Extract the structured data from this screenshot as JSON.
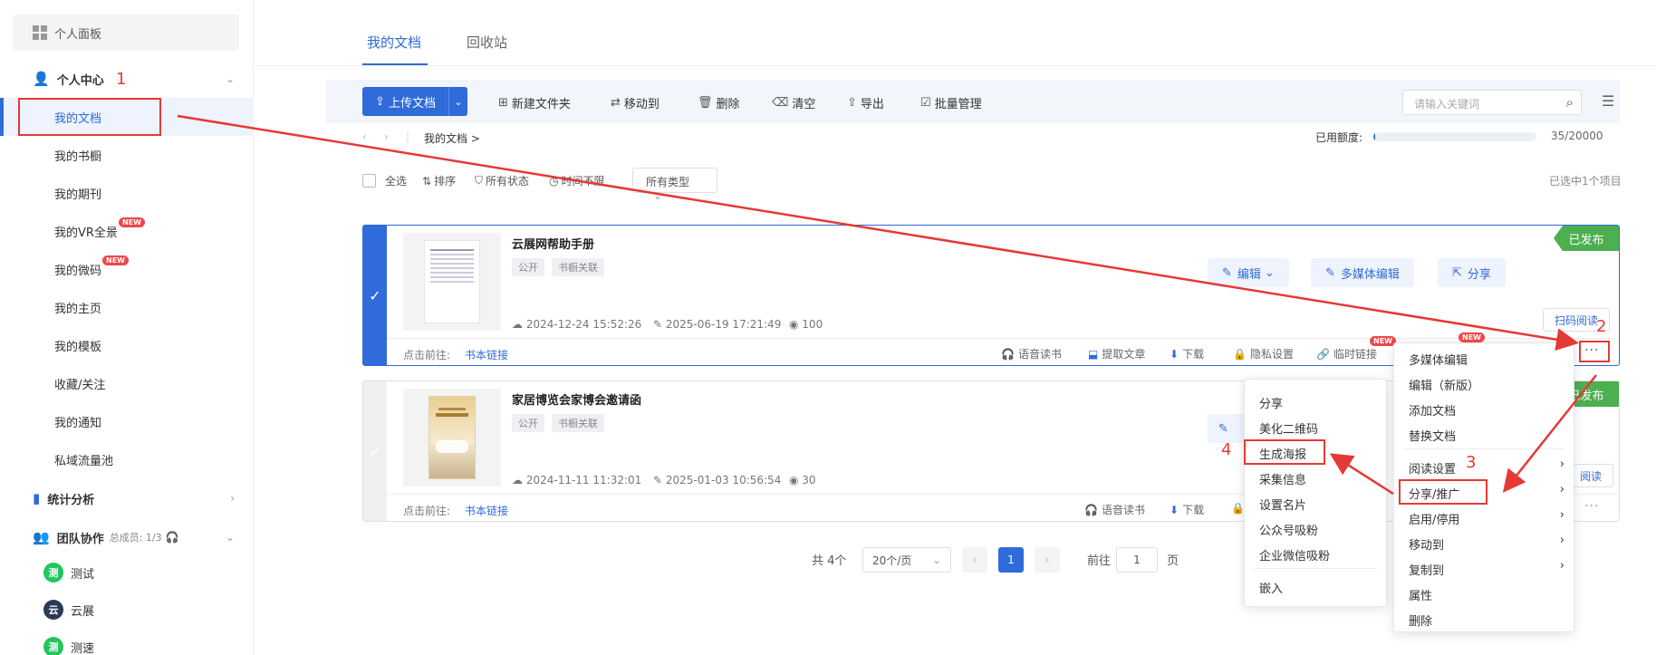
{
  "sidebar": {
    "panel_label": "个人面板",
    "personal_center": "个人中心",
    "items": [
      {
        "label": "我的文档"
      },
      {
        "label": "我的书橱"
      },
      {
        "label": "我的期刊"
      },
      {
        "label": "我的VR全景",
        "badge": "NEW"
      },
      {
        "label": "我的微码",
        "badge": "NEW"
      },
      {
        "label": "我的主页"
      },
      {
        "label": "我的模板"
      },
      {
        "label": "收藏/关注"
      },
      {
        "label": "我的通知"
      },
      {
        "label": "私域流量池"
      }
    ],
    "stats": "统计分析",
    "team": "团队协作",
    "team_members": "总成员: 1/3",
    "team_items": [
      {
        "avatar": "测",
        "label": "测试"
      },
      {
        "avatar": "云",
        "label": "云展"
      },
      {
        "avatar": "测",
        "label": "测速"
      }
    ]
  },
  "tabs": [
    "我的文档",
    "回收站"
  ],
  "toolbar": {
    "upload": "上传文档",
    "new_folder": "新建文件夹",
    "move_to": "移动到",
    "delete": "删除",
    "clear": "清空",
    "export": "导出",
    "batch": "批量管理",
    "search_placeholder": "请输入关键词"
  },
  "breadcrumb": {
    "current": "我的文档 >"
  },
  "quota": {
    "label": "已用额度:",
    "value": "35/20000",
    "fraction": 0.00175
  },
  "filters": {
    "select_all": "全选",
    "sort": "排序",
    "status": "所有状态",
    "time": "时间不限",
    "type": "所有类型",
    "selected_info": "已选中1个项目"
  },
  "documents": [
    {
      "title": "云展网帮助手册",
      "tags": [
        "公开",
        "书橱关联"
      ],
      "created": "2024-12-24 15:52:26",
      "updated": "2025-06-19 17:21:49",
      "views": "100",
      "status": "已发布",
      "goto_label": "点击前往:",
      "goto_link": "书本链接",
      "actions": {
        "edit": "编辑",
        "media_edit": "多媒体编辑",
        "share": "分享",
        "scan": "扫码阅读"
      },
      "footer_actions": [
        "语音读书",
        "提取文章",
        "下载",
        "隐私设置",
        "临时链接"
      ],
      "footer_badge": "NEW"
    },
    {
      "title": "家居博览会家博会邀请函",
      "tags": [
        "公开",
        "书橱关联"
      ],
      "created": "2024-11-11 11:32:01",
      "updated": "2025-01-03 10:56:54",
      "views": "30",
      "status": "已发布",
      "goto_label": "点击前往:",
      "goto_link": "书本链接",
      "actions": {
        "scan": "阅读"
      },
      "footer_actions": [
        "语音读书",
        "下载"
      ]
    }
  ],
  "pagination": {
    "total": "共 4个",
    "per_page": "20个/页",
    "current": "1",
    "goto": "前往",
    "goto_value": "1",
    "page": "页"
  },
  "more_menu": {
    "items": [
      "多媒体编辑",
      "编辑（新版）",
      "添加文档",
      "替换文档",
      "阅读设置",
      "分享/推广",
      "启用/停用",
      "移动到",
      "复制到",
      "属性",
      "删除"
    ],
    "badge": "NEW"
  },
  "share_menu": {
    "items": [
      "分享",
      "美化二维码",
      "生成海报",
      "采集信息",
      "设置名片",
      "公众号吸粉",
      "企业微信吸粉",
      "嵌入"
    ]
  },
  "annotations": [
    "1",
    "2",
    "3",
    "4"
  ],
  "colors": {
    "accent": "#2f6bd9",
    "published": "#4caf50",
    "annotation": "#e53935",
    "badge": "#f0464b"
  }
}
